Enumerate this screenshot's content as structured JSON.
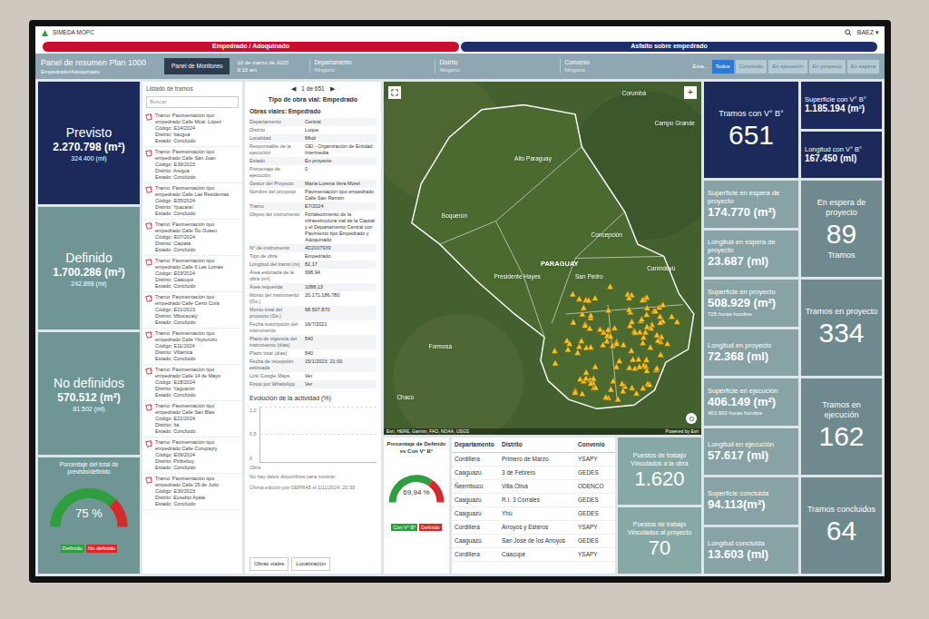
{
  "app": {
    "title": "SIMEDA MOPC",
    "user": "BAEZ",
    "user_caret": "▾"
  },
  "mode_tabs": [
    {
      "label": "Empedrado / Adoquinado",
      "color": "#c8102e"
    },
    {
      "label": "Asfalto sobre empedrado",
      "color": "#1d2f6b"
    }
  ],
  "header": {
    "title": "Panel de resumen Plan 1000",
    "subtitle": "Empedrado/Adoquinado",
    "button": "Panel de Monitoreo",
    "date": "10 de marzo de 2025",
    "time": "9:15 am",
    "filters": [
      {
        "label": "Departamento",
        "value": "Ninguno"
      },
      {
        "label": "Distrito",
        "value": "Ninguno"
      },
      {
        "label": "Convenio",
        "value": "Ninguno"
      }
    ],
    "status_label": "Esta...",
    "status_buttons": [
      {
        "label": "Todos",
        "selected": true
      },
      {
        "label": "Concluido",
        "selected": false
      },
      {
        "label": "En ejecución",
        "selected": false
      },
      {
        "label": "En proyecto",
        "selected": false
      },
      {
        "label": "En espera",
        "selected": false
      }
    ]
  },
  "summary": [
    {
      "kind": "primary",
      "label": "Previsto",
      "value": "2.270.798 (m²)",
      "sub": "324.400 (ml)"
    },
    {
      "kind": "secondary",
      "label": "Definido",
      "value": "1.700.286 (m²)",
      "sub": "242.898 (ml)"
    },
    {
      "kind": "secondary",
      "label": "No definidos",
      "value": "570.512 (m²)",
      "sub": "81.502 (ml)"
    }
  ],
  "gauge_total": {
    "title": "Porcentaje del total de previsto/definido",
    "reading": "75 %",
    "level": 0.75,
    "legend": [
      {
        "label": "Definido",
        "color": "#2e9e3e"
      },
      {
        "label": "No definido",
        "color": "#d62a2a"
      }
    ]
  },
  "list": {
    "title": "Listado de tramos",
    "search_placeholder": "Buscar",
    "items": [
      {
        "title": "Tramo: Pavimentación tipo empedrado Calle Mcal. López",
        "code": "Código: E14/2024",
        "district": "Distrito: Itauguá",
        "status": "Estado: Concluido"
      },
      {
        "title": "Tramo: Pavimentación tipo empedrado Calle San Juan",
        "code": "Código: E39/2023",
        "district": "Distrito: Areguá",
        "status": "Estado: Concluido"
      },
      {
        "title": "Tramo: Pavimentación tipo empedrado Calle Las Residentas",
        "code": "Código: E05/2024",
        "district": "Distrito: Ypacaraí",
        "status": "Estado: Concluido"
      },
      {
        "title": "Tramo: Pavimentación tipo empedrado Calle Ñu Guasú",
        "code": "Código: E07/2024",
        "district": "Distrito: Capiatá",
        "status": "Estado: Concluido"
      },
      {
        "title": "Tramo: Pavimentación tipo empedrado Calle 6 Las Lomas",
        "code": "Código: E03/2024",
        "district": "Distrito: Caacupé",
        "status": "Estado: Concluido"
      },
      {
        "title": "Tramo: Pavimentación tipo empedrado Calle Cerro Corá",
        "code": "Código: E21/2023",
        "district": "Distrito: Mbocayaty",
        "status": "Estado: Concluido"
      },
      {
        "title": "Tramo: Pavimentación tipo empedrado Calle Ybyturuzú",
        "code": "Código: E11/2024",
        "district": "Distrito: Villarrica",
        "status": "Estado: Concluido"
      },
      {
        "title": "Tramo: Pavimentación tipo empedrado Calle 14 de Mayo",
        "code": "Código: E18/2024",
        "district": "Distrito: Yaguarón",
        "status": "Estado: Concluido"
      },
      {
        "title": "Tramo: Pavimentación tipo empedrado Calle San Blas",
        "code": "Código: E22/2024",
        "district": "Distrito: Itá",
        "status": "Estado: Concluido"
      },
      {
        "title": "Tramo: Pavimentación tipo empedrado Calle Curupayty",
        "code": "Código: E09/2024",
        "district": "Distrito: Piribebuy",
        "status": "Estado: Concluido"
      },
      {
        "title": "Tramo: Pavimentación tipo empedrado Calle 25 de Julio",
        "code": "Código: E30/2023",
        "district": "Distrito: Eusebio Ayala",
        "status": "Estado: Concluido"
      }
    ]
  },
  "detail": {
    "prev": "◀",
    "pager": "1 de 651",
    "next": "▶",
    "type_title": "Tipo de obra vial: Empedrado",
    "section": "Obras viales: Empedrado",
    "fields": [
      {
        "label": "Departamento",
        "value": "Central"
      },
      {
        "label": "Distrito",
        "value": "Luque"
      },
      {
        "label": "Localidad",
        "value": "Mbói"
      },
      {
        "label": "Responsable de la ejecución",
        "value": "OEI - Organización de Entidad Intermedia"
      },
      {
        "label": "Estado",
        "value": "En proyecto"
      },
      {
        "label": "Porcentaje de ejecución",
        "value": "0"
      },
      {
        "label": "Gestor del Proyecto",
        "value": "María Lorena Vera Morel"
      },
      {
        "label": "Nombre del proyecto",
        "value": "Pavimentación tipo empedrado Calle San Ramón"
      },
      {
        "label": "Tramo",
        "value": "E7/2024"
      },
      {
        "label": "Objeto del instrumento",
        "value": "Fortalecimiento de la infraestructura vial de la Capital y el Departamento Central con Pavimento tipo Empedrado y Adoquinado"
      },
      {
        "label": "N° de instrumento",
        "value": "4D2007939"
      },
      {
        "label": "Tipo de obra",
        "value": "Empedrado"
      },
      {
        "label": "Longitud del tramo (m)",
        "value": "82,17"
      },
      {
        "label": "Área estimada de la obra (m²)",
        "value": "698,94"
      },
      {
        "label": "Área requerida",
        "value": "1088,13"
      },
      {
        "label": "Monto del instrumento (Gs.)",
        "value": "20.171.186.780"
      },
      {
        "label": "Monto total del proyecto (Gs.)",
        "value": "68.507.870"
      },
      {
        "label": "Fecha suscripción del instrumento",
        "value": "16/7/2021"
      },
      {
        "label": "Plazo de vigencia del instrumento (días)",
        "value": "540"
      },
      {
        "label": "Plazo total (días)",
        "value": "540"
      },
      {
        "label": "Fecha de recepción estimada",
        "value": "15/1/2023, 21:00"
      },
      {
        "label": "Link Google Maps",
        "value": "Ver"
      },
      {
        "label": "Fotos por WhatsApp",
        "value": "Ver"
      }
    ],
    "chart": {
      "title": "Evolución de la actividad (%)",
      "ticks": [
        "1,0",
        "0,5",
        "0"
      ],
      "x_label": "Obra",
      "note": "No hay datos disponibles para mostrar."
    },
    "footer": "Última edición por GEPRA5 el 1/11/2024, 20:39",
    "buttons": [
      "Obras viales",
      "Localización"
    ]
  },
  "map": {
    "labels": [
      "Corumbá",
      "Alto Paraguay",
      "Boquerón",
      "Presidente Hayes",
      "Concepción",
      "PARAGUAY",
      "San Pedro",
      "Canindeyú",
      "Formosa",
      "Chaco",
      "Campo Grande"
    ],
    "attribution": "Esri, HERE, Garmin, FAO, NOAA, USGS",
    "powered": "Powered by Esri",
    "zoom_in": "+"
  },
  "gauge_vb": {
    "title": "Porcentaje de Definido vs Con V° B°",
    "reading": "69,94 %",
    "level": 0.6994,
    "legend": [
      {
        "label": "Con V° B°",
        "color": "#2e9e3e"
      },
      {
        "label": "Definido",
        "color": "#d62a2a"
      }
    ]
  },
  "table": {
    "columns": [
      "Departamento",
      "Distrito",
      "Convenio"
    ],
    "rows": [
      [
        "Cordillera",
        "Primero de Marzo",
        "YSAPY"
      ],
      [
        "Caaguazú",
        "3 de Febrero",
        "GEDES"
      ],
      [
        "Ñeembucú",
        "Villa Oliva",
        "ODENCO"
      ],
      [
        "Caaguazú",
        "R.I. 3 Corrales",
        "GEDES"
      ],
      [
        "Caaguazú",
        "Yhú",
        "GEDES"
      ],
      [
        "Cordillera",
        "Arroyos y Esteros",
        "YSAPY"
      ],
      [
        "Caaguazú",
        "San José de los Arroyos",
        "GEDES"
      ],
      [
        "Cordillera",
        "Caacupé",
        "YSAPY"
      ]
    ]
  },
  "jobs": [
    {
      "label": "Puestos de trabajo Vinculados a la obra",
      "value": "1.620"
    },
    {
      "label": "Puestos de trabajo Vinculados al proyecto",
      "value": "70"
    }
  ],
  "stages": [
    {
      "kind": "total",
      "count_label": "Tramos con V° B°",
      "count": "651",
      "area_label": "Superficie con V° B°",
      "area": "1.185.194 (m²)",
      "length_label": "Longitud con V° B°",
      "length": "167.450 (ml)"
    },
    {
      "kind": "stage",
      "count_label": "En espera de proyecto",
      "count": "89",
      "count_unit": "Tramos",
      "area_label": "Superficie en espera de proyecto",
      "area": "174.770 (m²)",
      "length_label": "Longitud en espera de proyecto",
      "length": "23.687 (ml)"
    },
    {
      "kind": "stage",
      "count_label": "Tramos en proyecto",
      "count": "334",
      "area_label": "Superficie en proyecto",
      "area": "508.929 (m²)",
      "area_note": "725 horas hombre",
      "length_label": "Longitud en proyecto",
      "length": "72.368 (ml)"
    },
    {
      "kind": "stage",
      "count_label": "Tramos en ejecución",
      "count": "162",
      "area_label": "Superficie en ejecución",
      "area": "406.149 (m²)",
      "area_note": "463.993 horas hombre",
      "length_label": "Longitud en ejecución",
      "length": "57.617 (ml)"
    },
    {
      "kind": "stage",
      "count_label": "Tramos concluidos",
      "count": "64",
      "area_label": "Superficie concluida",
      "area": "94.113(m²)",
      "length_label": "Longitud concluida",
      "length": "13.603 (ml)"
    }
  ]
}
